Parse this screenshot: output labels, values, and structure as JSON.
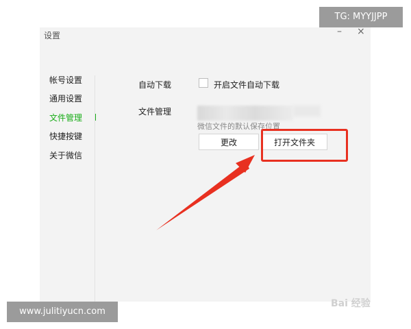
{
  "window": {
    "title": "设置",
    "minimize_glyph": "–",
    "close_glyph": "×"
  },
  "sidebar": {
    "items": [
      {
        "label": "帐号设置"
      },
      {
        "label": "通用设置"
      },
      {
        "label": "文件管理",
        "active": true
      },
      {
        "label": "快捷按键"
      },
      {
        "label": "关于微信"
      }
    ]
  },
  "settings": {
    "auto_download_label": "自动下载",
    "auto_download_checkbox_label": "开启文件自动下载",
    "file_manage_label": "文件管理",
    "path_hint": "微信文件的默认保存位置",
    "change_button": "更改",
    "open_folder_button": "打开文件夹"
  },
  "overlays": {
    "tg_badge": "TG: MYYJJPP",
    "site_badge": "www.julitiyucn.com",
    "watermark": "Bai 经验"
  },
  "colors": {
    "accent": "#1aad19",
    "annotation_red": "#e83020"
  }
}
